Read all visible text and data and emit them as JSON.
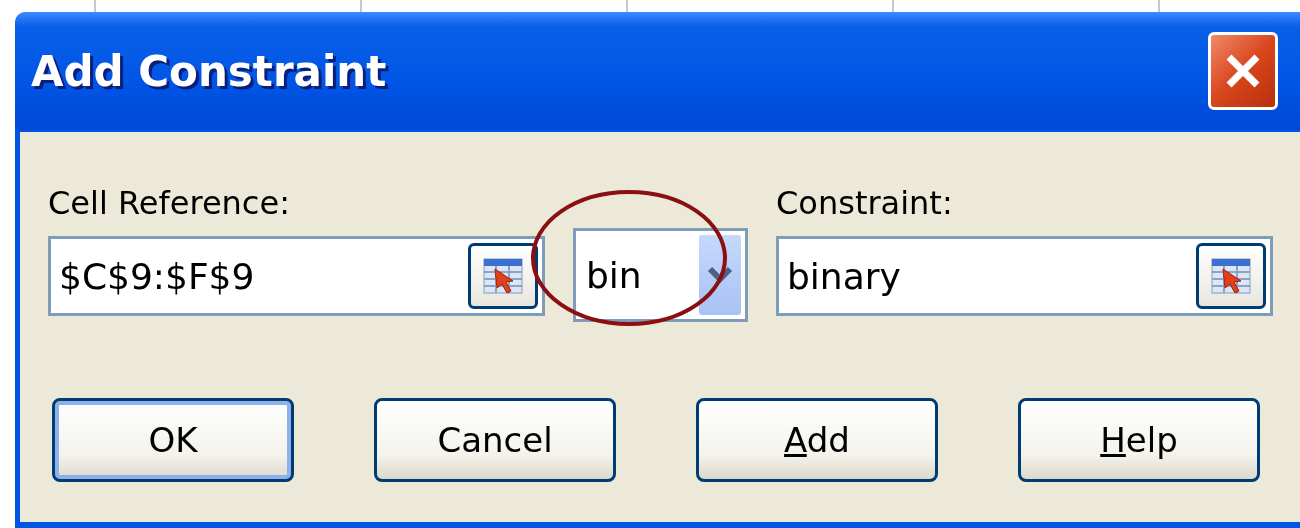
{
  "window": {
    "title": "Add Constraint"
  },
  "cell_reference": {
    "label": "Cell Reference:",
    "value": "$C$9:$F$9"
  },
  "operator": {
    "value": "bin",
    "highlighted": true
  },
  "constraint": {
    "label": "Constraint:",
    "value": "binary"
  },
  "buttons": [
    {
      "label": "OK",
      "default": true,
      "underline_first": false
    },
    {
      "label": "Cancel",
      "default": false,
      "underline_first": false
    },
    {
      "label": "Add",
      "default": false,
      "underline_first": true
    },
    {
      "label": "Help",
      "default": false,
      "underline_first": true
    }
  ]
}
